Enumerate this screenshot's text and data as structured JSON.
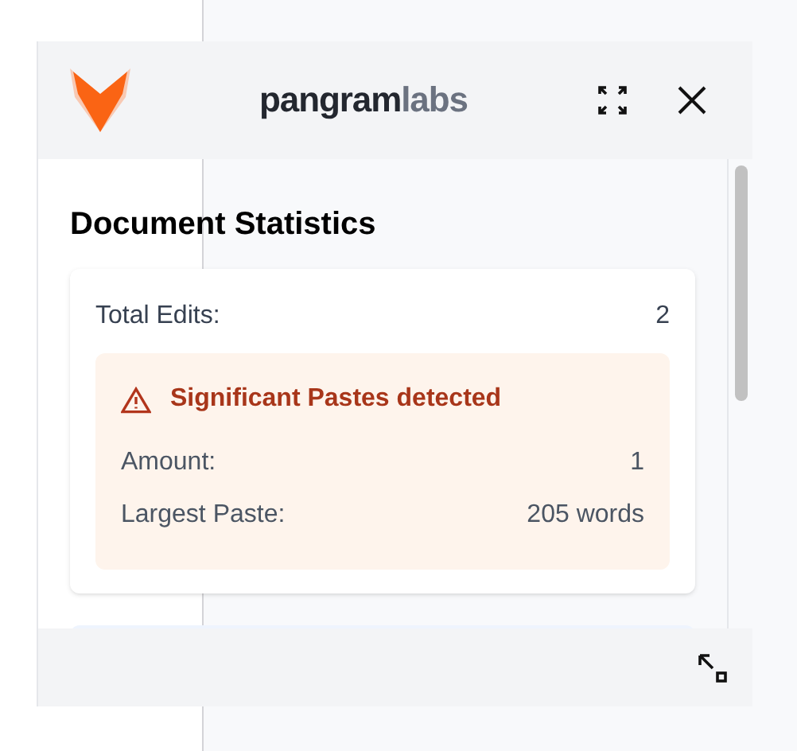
{
  "header": {
    "brand": {
      "primary": "pangram",
      "secondary": "labs"
    }
  },
  "section": {
    "title": "Document Statistics",
    "stats": [
      {
        "label": "Total Edits:",
        "value": "2"
      }
    ],
    "alert": {
      "title": "Significant Pastes detected",
      "rows": [
        {
          "label": "Amount:",
          "value": "1"
        },
        {
          "label": "Largest Paste:",
          "value": "205 words"
        }
      ]
    }
  }
}
